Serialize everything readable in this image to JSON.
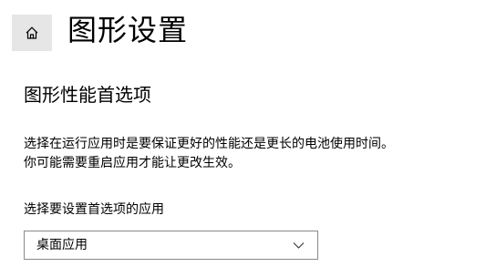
{
  "header": {
    "home_icon": "home-icon",
    "title": "图形设置"
  },
  "section": {
    "heading": "图形性能首选项",
    "description_line1": "选择在运行应用时是要保证更好的性能还是更长的电池使用时间。",
    "description_line2": "你可能需要重启应用才能让更改生效。"
  },
  "app_select": {
    "label": "选择要设置首选项的应用",
    "selected_value": "桌面应用",
    "icon": "chevron-down-icon"
  }
}
